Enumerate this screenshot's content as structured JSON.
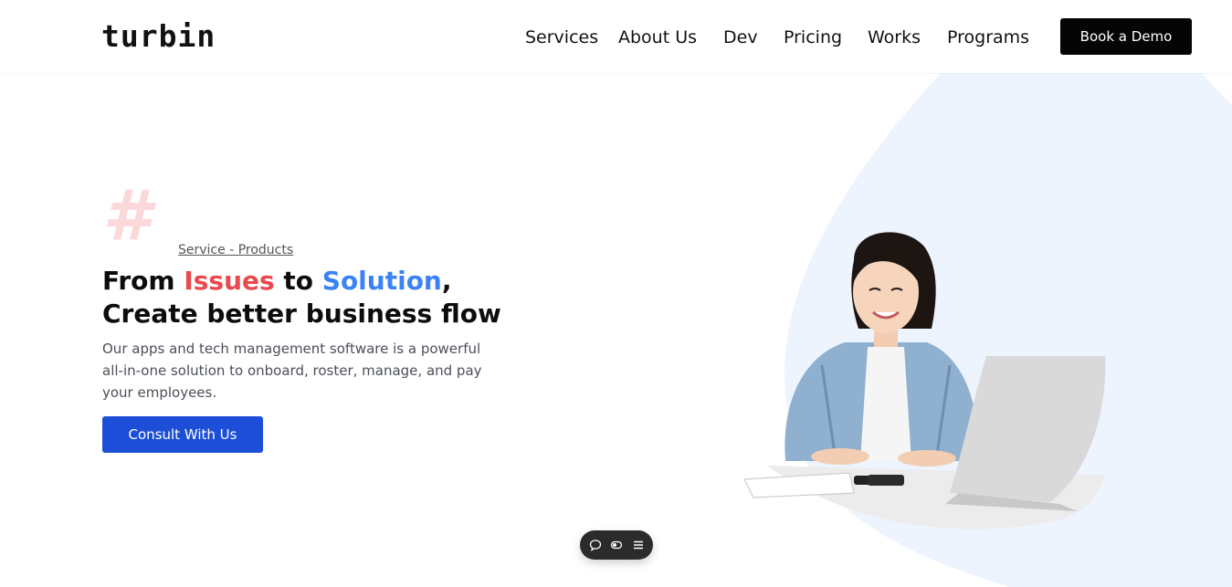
{
  "brand": {
    "logo": "turbin"
  },
  "nav": {
    "items": [
      {
        "label": "Services"
      },
      {
        "label": "About Us"
      },
      {
        "label": "Dev"
      },
      {
        "label": "Pricing"
      },
      {
        "label": "Works"
      },
      {
        "label": "Programs"
      }
    ],
    "cta_label": "Book a Demo"
  },
  "hero": {
    "hash_symbol": "#",
    "eyebrow": "Service - Products",
    "headline": {
      "part1": "From ",
      "issues": "Issues",
      "part2": " to ",
      "solution": "Solution",
      "part3": ",",
      "line2": "Create better business flow"
    },
    "description": "Our apps and tech management software is a powerful all-in-one solution to onboard, roster, manage, and pay your employees.",
    "cta_label": "Consult With Us"
  },
  "colors": {
    "accent_red": "#e84a4f",
    "accent_blue": "#3b82f6",
    "button_blue": "#1d4ed8",
    "dark_button": "#050505",
    "bg_shape": "#eef4fd",
    "hash": "#fbd9da"
  },
  "toolbar": {
    "icons": [
      "chat-bubble-icon",
      "toggle-icon",
      "menu-icon"
    ]
  }
}
